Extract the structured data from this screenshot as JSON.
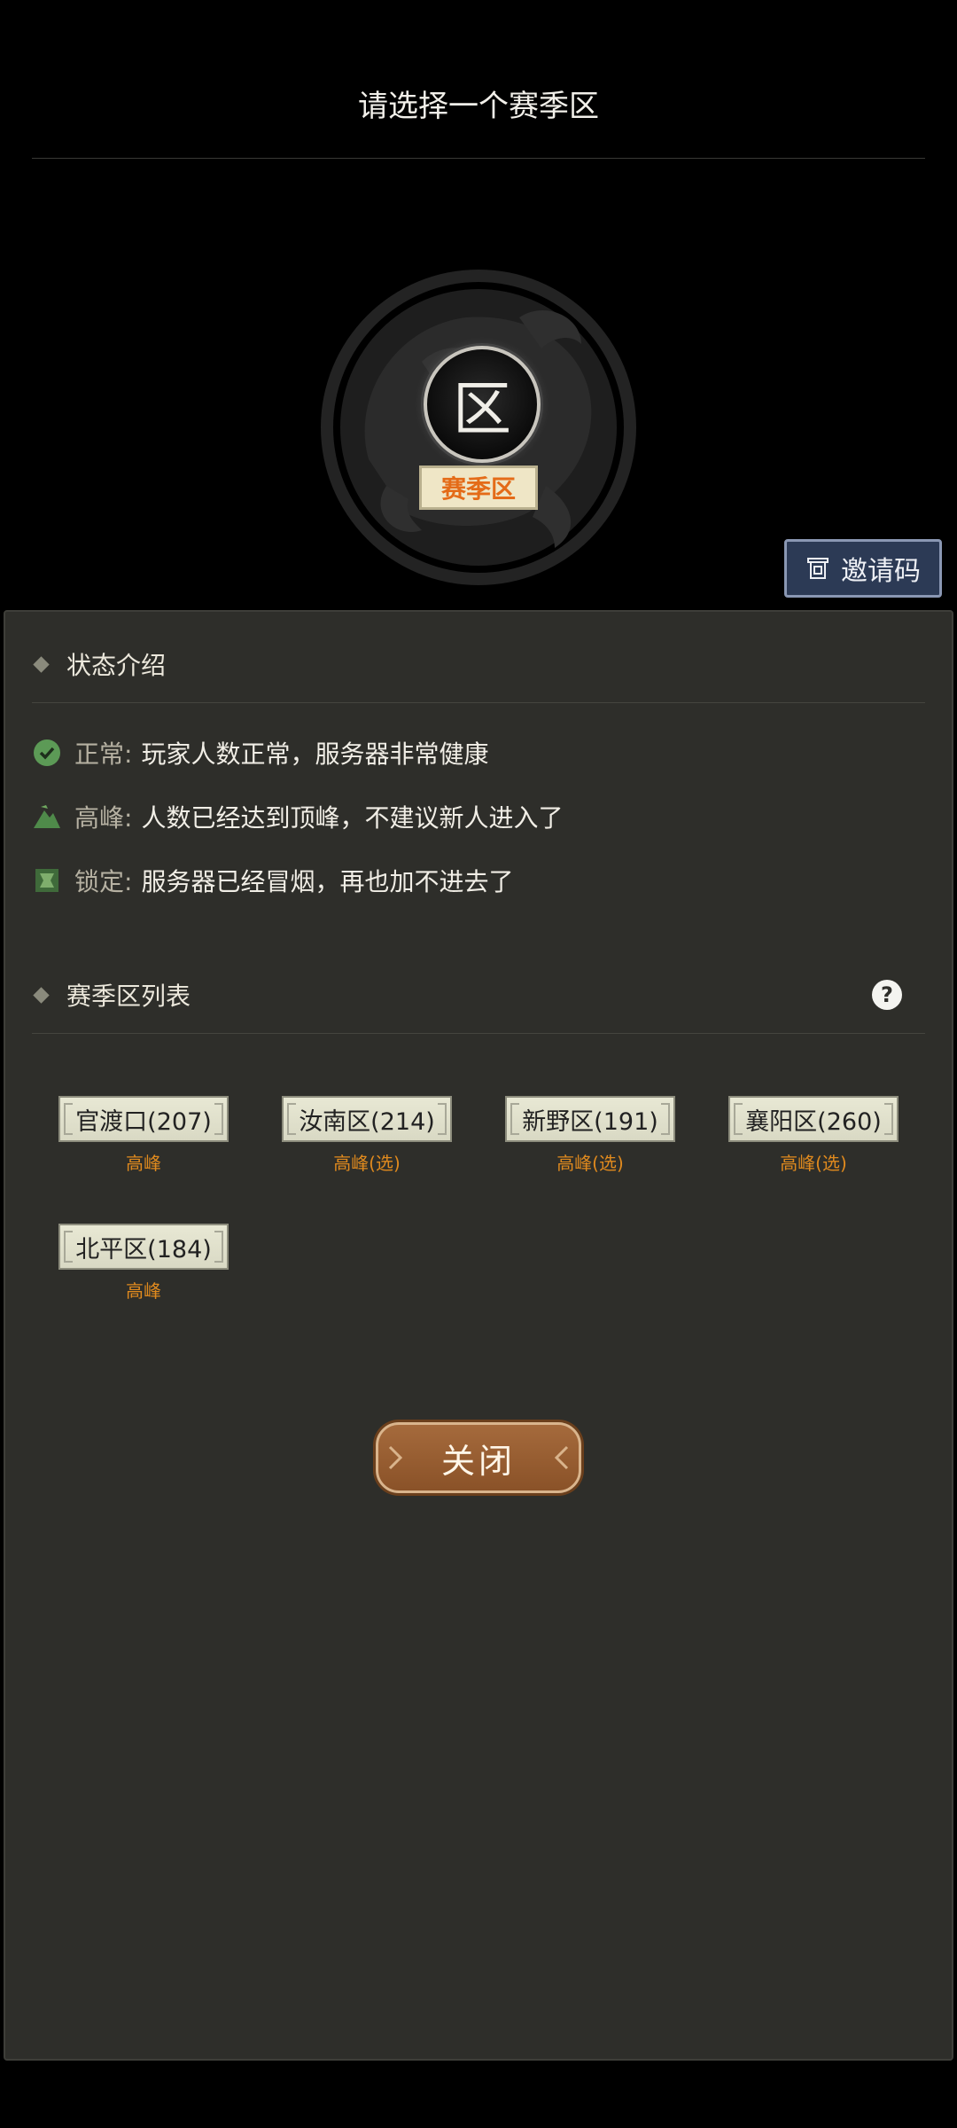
{
  "header": {
    "title": "请选择一个赛季区"
  },
  "emblem": {
    "badge_char": "区",
    "tag": "赛季区"
  },
  "invite_button": {
    "label": "邀请码"
  },
  "status_section": {
    "heading": "状态介绍",
    "items": [
      {
        "label": "正常:",
        "desc": "玩家人数正常，服务器非常健康",
        "icon": "check-circle-icon"
      },
      {
        "label": "高峰:",
        "desc": "人数已经达到顶峰，不建议新人进入了",
        "icon": "peak-icon"
      },
      {
        "label": "锁定:",
        "desc": "服务器已经冒烟，再也加不进去了",
        "icon": "lock-icon"
      }
    ]
  },
  "season_list": {
    "heading": "赛季区列表",
    "help_icon": "?",
    "servers": [
      {
        "name": "官渡口(207)",
        "state": "高峰"
      },
      {
        "name": "汝南区(214)",
        "state": "高峰(选)"
      },
      {
        "name": "新野区(191)",
        "state": "高峰(选)"
      },
      {
        "name": "襄阳区(260)",
        "state": "高峰(选)"
      },
      {
        "name": "北平区(184)",
        "state": "高峰"
      }
    ]
  },
  "close_button": {
    "label": "关闭"
  },
  "colors": {
    "background": "#000000",
    "panel": "#2e2e2a",
    "peak_state": "#e08a1e",
    "season_tag_text": "#e46b18",
    "invite_button": "#2c3a55",
    "close_button": "#8a5228",
    "normal_icon": "#5c9a56"
  }
}
